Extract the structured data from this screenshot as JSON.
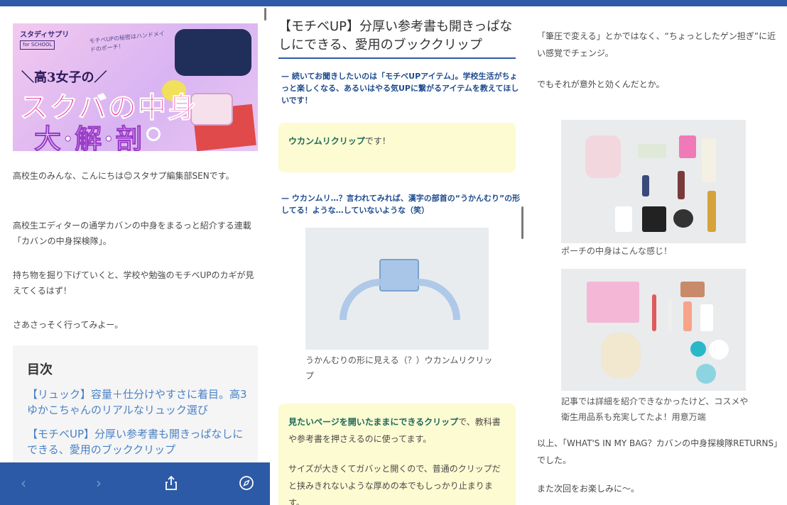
{
  "col1": {
    "banner": {
      "brand": "スタディサプリ",
      "brand_sub": "for SCHOOL",
      "tagline": "モチベUPの秘密はハンドメイドのポーチ！",
      "kicker": "＼高3女子の／",
      "title_line1": "スクバの中身",
      "title_line2": "大·解·剖"
    },
    "paragraphs": [
      "高校生のみんな、こんにちは😊スタサプ編集部SENです。",
      "高校生エディターの通学カバンの中身をまるっと紹介する連載「カバンの中身探検隊」。",
      "持ち物を掘り下げていくと、学校や勉強のモチベUPのカギが見えてくるはず！",
      "さあさっそく行ってみよー。"
    ],
    "toc": {
      "title": "目次",
      "links": [
        "【リュック】容量＋仕分けやすさに着目。高3ゆかこちゃんのリアルなリュック選び",
        "【モチベUP】分厚い参考書も開きっぱなしにできる、愛用のブッククリップ"
      ]
    },
    "nav": {
      "back_icon": "‹",
      "forward_icon": "›",
      "share_icon": "⇧",
      "compass_icon": "⊘"
    }
  },
  "col2": {
    "title": "【モチベUP】分厚い参考書も開きっぱなしにできる、愛用のブッククリップ",
    "q1": "— 続いてお聞きしたいのは「モチベUPアイテム」。学校生活がちょっと楽しくなる、あるいはやる気UPに繋がるアイテムを教えてほしいです！",
    "a1_highlight": "ウカンムリクリップ",
    "a1_rest": "です！",
    "q2": "— ウカンムリ…？言われてみれば、漢字の部首の“うかんむり”の形してる！ような…していないような（笑）",
    "photo_caption": "うかんむりの形に見える（？）ウカンムリクリップ",
    "a2_highlight": "見たいページを開いたままにできるクリップ",
    "a2_rest": "で、教科書や参考書を押さえるのに使ってます。",
    "a3": "サイズが大きくてガバッと開くので、普通のクリップだと挟みきれないような厚めの本でもしっかり止まります。"
  },
  "col3": {
    "p1": "「筆圧で変える」とかではなく、“ちょっとしたゲン担ぎ”に近い感覚でチェンジ。",
    "p2": "でもそれが意外と効くんだとか。",
    "caption1": "ポーチの中身はこんな感じ！",
    "caption2": "記事では詳細を紹介できなかったけど、コスメや衛生用品系も充実してたよ！用意万端",
    "p3": "以上、「WHAT'S IN MY BAG？カバンの中身探検隊RETURNS」でした。",
    "p4": "また次回をお楽しみに〜。"
  },
  "colors": {
    "top_bar": "#2f5aa8",
    "nav_bar": "#2d5aa6",
    "link": "#4a82c6",
    "question": "#1f4c8e",
    "highlight_box": "#fcfbd2"
  }
}
